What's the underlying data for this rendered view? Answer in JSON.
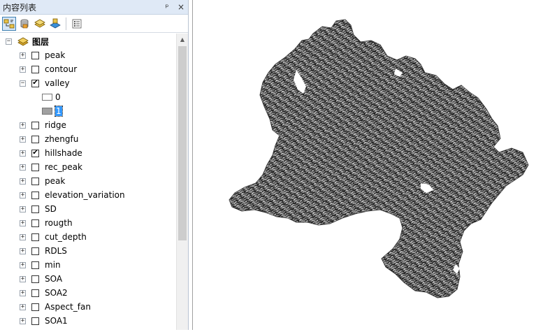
{
  "panel": {
    "title": "内容列表",
    "pin_glyph": "ᵖ",
    "close_glyph": "×"
  },
  "toolbar": {
    "buttons": [
      {
        "icon": "list-by-drawing-order-icon"
      },
      {
        "icon": "list-by-source-icon"
      },
      {
        "icon": "list-by-visibility-icon"
      },
      {
        "icon": "list-by-selection-icon"
      },
      {
        "icon": "options-icon"
      }
    ]
  },
  "tree": {
    "root_label": "图层",
    "layers": [
      {
        "name": "peak",
        "checked": false
      },
      {
        "name": "contour",
        "checked": false
      },
      {
        "name": "valley",
        "checked": true,
        "expanded": true,
        "legend": [
          {
            "label": "0",
            "color": "#ffffff"
          },
          {
            "label": "1",
            "color": "#a0a0a0"
          }
        ]
      },
      {
        "name": "ridge",
        "checked": false
      },
      {
        "name": "zhengfu",
        "checked": false
      },
      {
        "name": "hillshade",
        "checked": true
      },
      {
        "name": "rec_peak",
        "checked": false
      },
      {
        "name": "peak",
        "checked": false
      },
      {
        "name": "elevation_variation",
        "checked": false
      },
      {
        "name": "SD",
        "checked": false
      },
      {
        "name": "rougth",
        "checked": false
      },
      {
        "name": "cut_depth",
        "checked": false
      },
      {
        "name": "RDLS",
        "checked": false
      },
      {
        "name": "min",
        "checked": false
      },
      {
        "name": "SOA",
        "checked": false
      },
      {
        "name": "SOA2",
        "checked": false
      },
      {
        "name": "Aspect_fan",
        "checked": false
      },
      {
        "name": "SOA1",
        "checked": false
      }
    ]
  },
  "colors": {
    "selection": "#3399ff",
    "raster_fill": "#8f8f8f",
    "raster_dark": "#1a1a1a"
  }
}
